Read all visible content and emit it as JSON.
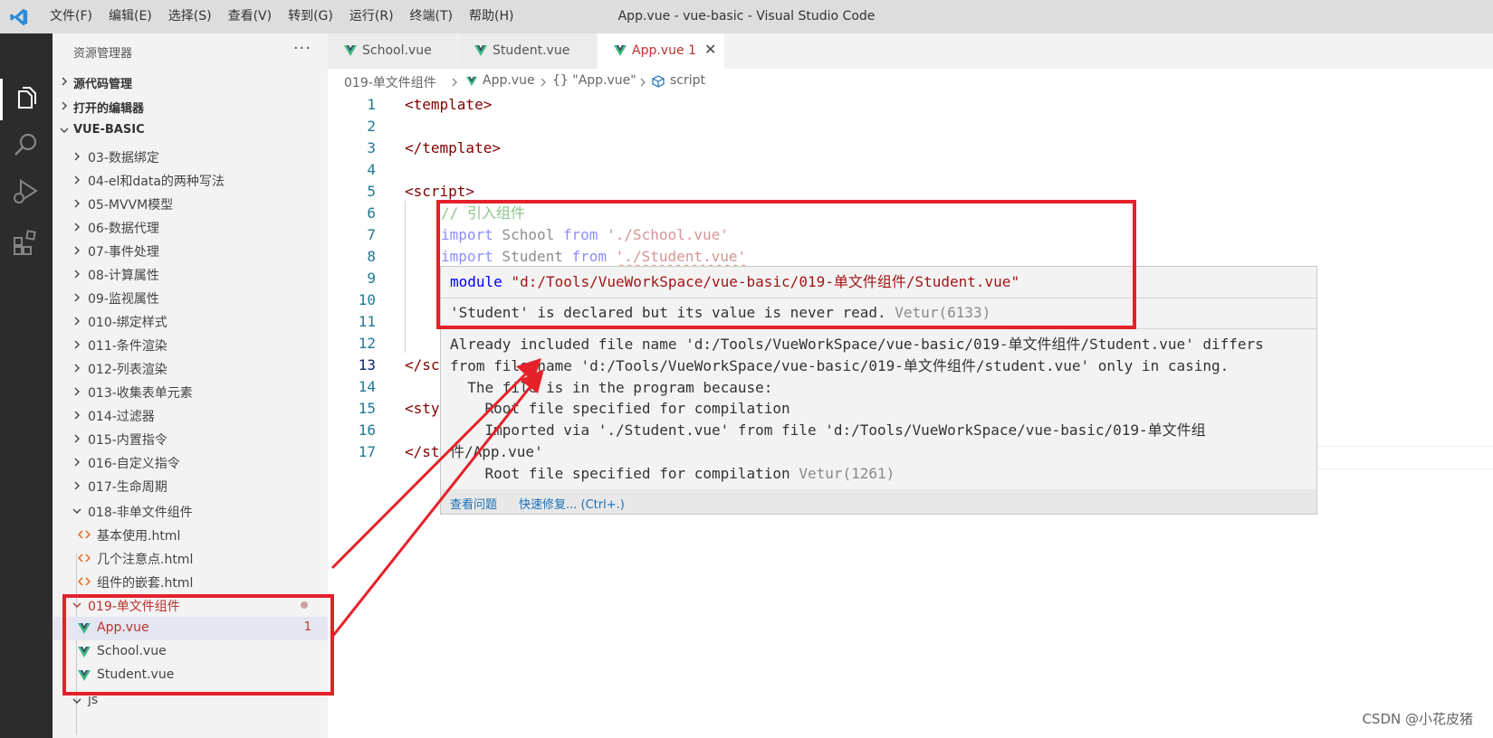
{
  "titlebar": {
    "menu": [
      "文件(F)",
      "编辑(E)",
      "选择(S)",
      "查看(V)",
      "转到(G)",
      "运行(R)",
      "终端(T)",
      "帮助(H)"
    ],
    "title": "App.vue - vue-basic - Visual Studio Code"
  },
  "sidebar": {
    "title": "资源管理器",
    "more": "···",
    "sections": [
      "源代码管理",
      "打开的编辑器",
      "VUE-BASIC"
    ],
    "folders": [
      "03-数据绑定",
      "04-el和data的两种写法",
      "05-MVVM模型",
      "06-数据代理",
      "07-事件处理",
      "08-计算属性",
      "09-监视属性",
      "010-绑定样式",
      "011-条件渲染",
      "012-列表渲染",
      "013-收集表单元素",
      "014-过滤器",
      "015-内置指令",
      "016-自定义指令",
      "017-生命周期"
    ],
    "folder018": "018-非单文件组件",
    "files018": [
      "基本使用.html",
      "几个注意点.html",
      "组件的嵌套.html"
    ],
    "folder019": "019-单文件组件",
    "files019": [
      "App.vue",
      "School.vue",
      "Student.vue"
    ],
    "app_badge": "1",
    "next_folder": "js"
  },
  "tabs": [
    {
      "label": "School.vue"
    },
    {
      "label": "Student.vue"
    },
    {
      "label": "App.vue",
      "count": "1",
      "close": "✕"
    }
  ],
  "breadcrumb": [
    "019-单文件组件",
    "App.vue",
    "{} \"App.vue\"",
    "script"
  ],
  "code": {
    "line_numbers": [
      "1",
      "2",
      "3",
      "4",
      "5",
      "6",
      "7",
      "8",
      "9",
      "10",
      "11",
      "12",
      "13",
      "14",
      "15",
      "16",
      "17"
    ],
    "template_open": "<template>",
    "template_close": "</template>",
    "script_open": "<script>",
    "comment": "// 引入组件",
    "kw_import": "import",
    "school": " School ",
    "student": " Student ",
    "kw_from": "from",
    "school_path": "'./School.vue'",
    "student_path": "'./Student.vue'",
    "script_close": "</sc",
    "style_open": "<sty",
    "style_close": "</st"
  },
  "hover": {
    "kw_module": "module",
    "module_path": " \"d:/Tools/VueWorkSpace/vue-basic/019-单文件组件/Student.vue\"",
    "warning": "'Student' is declared but its value is never read.",
    "warning_src": "Vetur(6133)",
    "error_lines": [
      "Already included file name 'd:/Tools/VueWorkSpace/vue-basic/019-单文件组件/Student.vue' differs",
      "from file name 'd:/Tools/VueWorkSpace/vue-basic/019-单文件组件/student.vue' only in casing.",
      "  The file is in the program because:",
      "    Root file specified for compilation",
      "    Imported via './Student.vue' from file 'd:/Tools/VueWorkSpace/vue-basic/019-单文件组",
      "件/App.vue'",
      "    Root file specified for compilation"
    ],
    "error_src": "Vetur(1261)",
    "actions": [
      "查看问题",
      "快速修复... (Ctrl+.)"
    ]
  },
  "watermark": "CSDN @小花皮猪",
  "colors": {
    "annotation": "#e5212a",
    "vue_green": "#41b883",
    "error": "#b8332f"
  }
}
